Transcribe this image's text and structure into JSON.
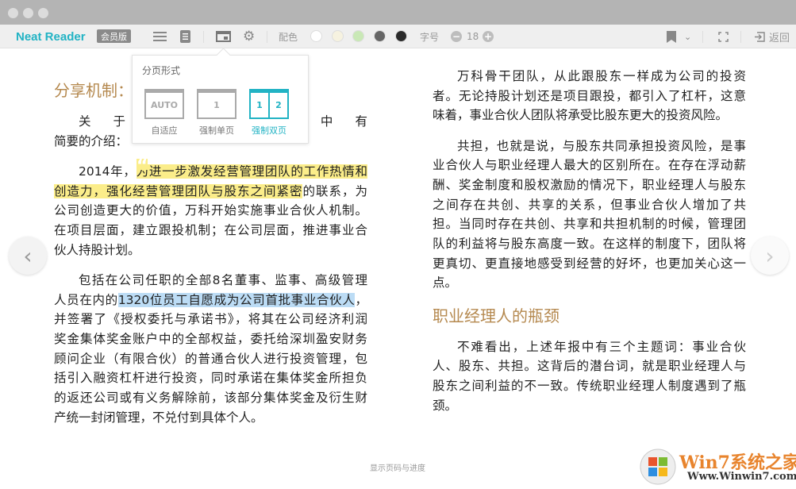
{
  "toolbar": {
    "brand": "Neat Reader",
    "badge": "会员版",
    "color_label": "配色",
    "font_label": "字号",
    "font_size": "18",
    "back_label": "返回",
    "swatches": [
      "#ffffff",
      "#f6f2e0",
      "#c9e8b6",
      "#666666",
      "#2b2b2b"
    ],
    "accent": "#22b3c4"
  },
  "popup": {
    "title": "分页形式",
    "options": [
      {
        "icon_text": "AUTO",
        "label": "自适应"
      },
      {
        "icon_text": "1",
        "label": "强制单页"
      },
      {
        "icon_text": [
          "1",
          "2"
        ],
        "label": "强制双页",
        "selected": true
      }
    ]
  },
  "left": {
    "heading": "分享机制：",
    "paragraphs": [
      [
        [
          {
            "t": "关于事业"
          },
          {
            "t": "年年报中有"
          }
        ],
        [
          {
            "t": "简要的介绍："
          }
        ]
      ],
      [
        [
          {
            "t": "2014年，"
          },
          {
            "t": "为进一步激发经营管理团队的工作热情和",
            "hl": "y"
          }
        ],
        [
          {
            "t": "创造力，强化经营管理团队与股东之间紧密",
            "hl": "y"
          },
          {
            "t": "的联系，为"
          }
        ],
        [
          {
            "t": "公司创造更大的价值，万科开始实施事业合伙人机制。"
          }
        ],
        [
          {
            "t": "在项目层面，建立跟投机制；在公司层面，推进事业合"
          }
        ],
        [
          {
            "t": "伙人持股计划。"
          }
        ]
      ],
      [
        [
          {
            "t": "包括在公司任职的全部8名董事、监事、高级管理"
          }
        ],
        [
          {
            "t": "人员在内的"
          },
          {
            "t": "1320位员工自愿成为公司首批事业合伙人",
            "hl": "b"
          },
          {
            "t": "，"
          }
        ],
        [
          {
            "t": "并签署了《授权委托与承诺书》，将其在公司经济利润"
          }
        ],
        [
          {
            "t": "奖金集体奖金账户中的全部权益，委托给深圳盈安财务"
          }
        ],
        [
          {
            "t": "顾问企业（有限合伙）的普通合伙人进行投资管理，包"
          }
        ],
        [
          {
            "t": "括引入融资杠杆进行投资，同时承诺在集体奖金所担负"
          }
        ],
        [
          {
            "t": "的返还公司或有义务解除前，该部分集体奖金及衍生财"
          }
        ],
        [
          {
            "t": "产统一封闭管理，不兑付到具体个人。"
          }
        ]
      ]
    ]
  },
  "right": {
    "paragraphs": [
      [
        [
          {
            "t": "万科骨干团队，从此跟股东一样成为公司的投资"
          }
        ],
        [
          {
            "t": "者。无论持股计划还是项目跟投，都引入了杠杆，这意"
          }
        ],
        [
          {
            "t": "味着，事业合伙人团队将承受比股东更大的投资风险。"
          }
        ]
      ],
      [
        [
          {
            "t": "共担，也就是说，与股东共同承担投资风险，是事"
          }
        ],
        [
          {
            "t": "业合伙人与职业经理人最大的区别所在。在存在浮动薪"
          }
        ],
        [
          {
            "t": "酬、奖金制度和股权激励的情况下，职业经理人与股东"
          }
        ],
        [
          {
            "t": "之间存在共创、共享的关系，但事业合伙人增加了共"
          }
        ],
        [
          {
            "t": "担。当同时存在共创、共享和共担机制的时候，管理团"
          }
        ],
        [
          {
            "t": "队的利益将与股东高度一致。在这样的制度下，团队将"
          }
        ],
        [
          {
            "t": "更真切、更直接地感受到经营的好坏，也更加关心这一"
          }
        ],
        [
          {
            "t": "点。"
          }
        ]
      ]
    ],
    "heading": "职业经理人的瓶颈",
    "paragraphs2": [
      [
        [
          {
            "t": "不难看出，上述年报中有三个主题词：事业合伙"
          }
        ],
        [
          {
            "t": "人、股东、共担。这背后的潜台词，就是职业经理人与"
          }
        ],
        [
          {
            "t": "股东之间利益的不一致。传统职业经理人制度遇到了瓶"
          }
        ],
        [
          {
            "t": "颈。"
          }
        ]
      ]
    ]
  },
  "footer": {
    "progress_label": "显示页码与进度"
  },
  "watermark": {
    "title": "Win7系统之家",
    "url": "Www.Winwin7.com"
  }
}
